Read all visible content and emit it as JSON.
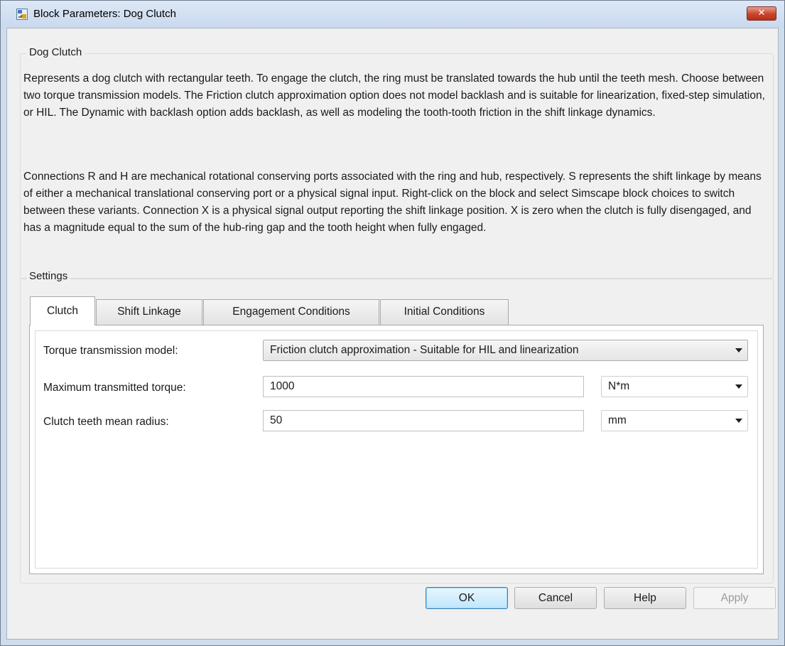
{
  "window": {
    "title": "Block Parameters: Dog Clutch",
    "close_symbol": "✕"
  },
  "description": {
    "group_title": "Dog Clutch",
    "paragraph_1": "Represents a dog clutch with rectangular teeth. To engage the clutch, the ring must be translated towards the hub until the teeth mesh. Choose between two torque transmission models. The Friction clutch approximation option does not model backlash and is suitable for linearization, fixed-step simulation, or HIL. The Dynamic with backlash option adds backlash, as well as modeling the tooth-tooth friction in the shift linkage dynamics.",
    "paragraph_2": "Connections R and H are mechanical rotational conserving ports associated with the ring and hub, respectively. S represents the shift linkage by means of either a mechanical translational conserving port or a physical signal input. Right-click on the block and select Simscape block choices to switch between these variants. Connection X is a physical signal output reporting the shift linkage position. X is zero when the clutch is fully disengaged, and has a magnitude equal to the sum of the hub-ring gap and the tooth height when fully engaged."
  },
  "settings": {
    "group_title": "Settings",
    "tabs": [
      {
        "label": "Clutch",
        "active": true
      },
      {
        "label": "Shift Linkage",
        "active": false
      },
      {
        "label": "Engagement Conditions",
        "active": false
      },
      {
        "label": "Initial Conditions",
        "active": false
      }
    ],
    "params": {
      "torque_model": {
        "label": "Torque transmission model:",
        "value": "Friction clutch approximation - Suitable for HIL and linearization"
      },
      "max_torque": {
        "label": "Maximum transmitted torque:",
        "value": "1000",
        "unit": "N*m"
      },
      "mean_radius": {
        "label": "Clutch teeth mean radius:",
        "value": "50",
        "unit": "mm"
      }
    }
  },
  "buttons": {
    "ok": "OK",
    "cancel": "Cancel",
    "help": "Help",
    "apply": "Apply"
  },
  "icons": {
    "app": "block-parameters-icon",
    "close": "close-icon",
    "dropdown": "chevron-down-icon"
  },
  "colors": {
    "close_button": "#c8432c",
    "default_button": "#bee6fd"
  }
}
